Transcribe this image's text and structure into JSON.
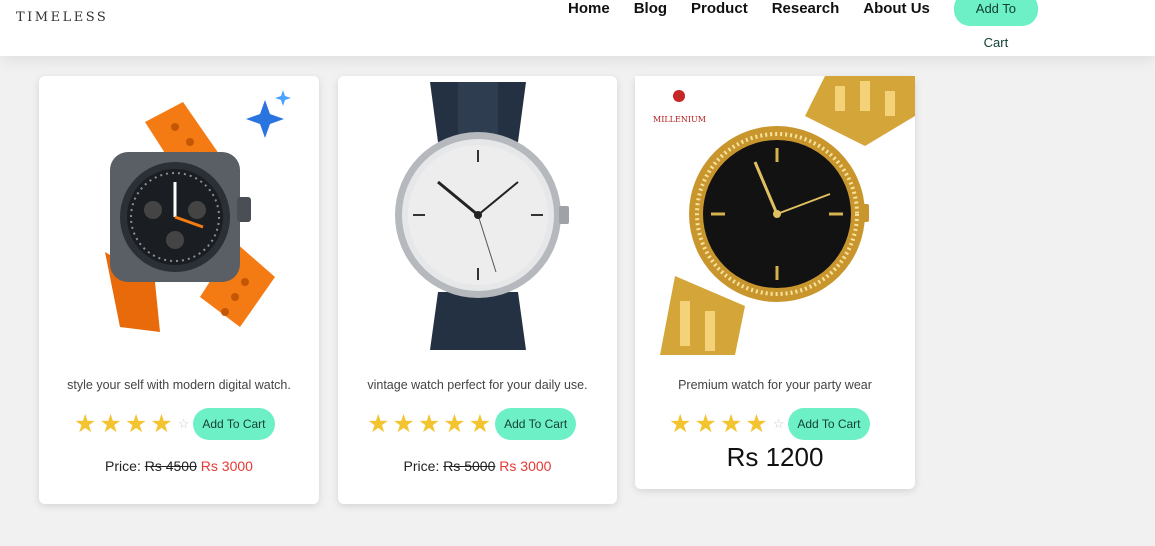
{
  "header": {
    "brand": "TIMELESS",
    "nav": [
      "Home",
      "Blog",
      "Product",
      "Research",
      "About Us"
    ],
    "cart_label": "Add To Cart"
  },
  "products": [
    {
      "description": "style your self with modern digital watch.",
      "rating": 4,
      "max_rating": 5,
      "cart_label": "Add To Cart",
      "price_label": "Price:",
      "old_price": "Rs 4500",
      "new_price": "Rs 3000"
    },
    {
      "description": "vintage watch perfect for your daily use.",
      "rating": 5,
      "max_rating": 5,
      "cart_label": "Add To Cart",
      "price_label": "Price:",
      "old_price": "Rs 5000",
      "new_price": "Rs 3000"
    },
    {
      "description": "Premium watch for your party wear",
      "rating": 4,
      "max_rating": 5,
      "cart_label": "Add To Cart",
      "price": "Rs 1200",
      "image_brand": "MILLENIUM"
    }
  ],
  "colors": {
    "accent": "#6ef0c6",
    "star": "#f4c430",
    "sale_price": "#e53935"
  }
}
